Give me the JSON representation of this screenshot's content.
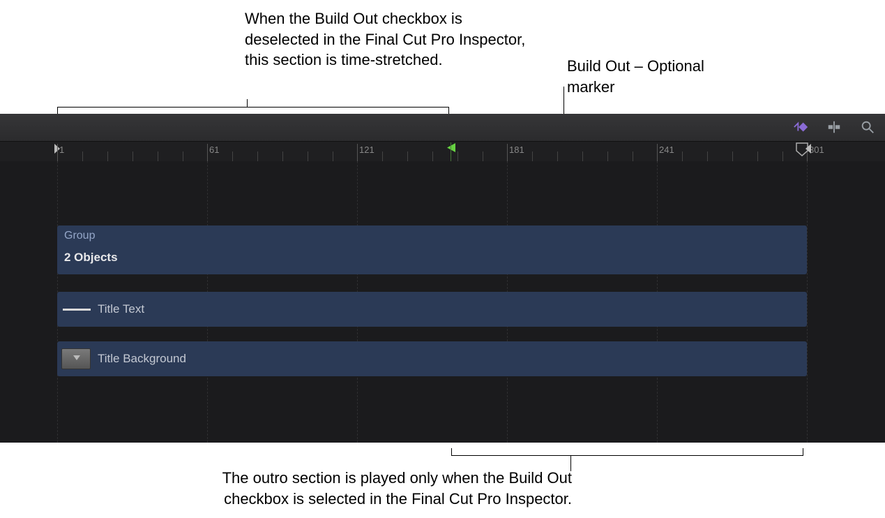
{
  "annotations": {
    "top_left": "When the Build Out checkbox is deselected in the Final Cut Pro Inspector, this section is time-stretched.",
    "top_right": "Build Out – Optional marker",
    "bottom": "The outro section is played only when the Build Out checkbox is selected in the Final Cut Pro Inspector."
  },
  "ruler": {
    "labels": [
      "1",
      "61",
      "121",
      "181",
      "241",
      "301"
    ]
  },
  "tracks": {
    "group_label": "Group",
    "group_sub": "2 Objects",
    "title_text": "Title Text",
    "title_bg": "Title Background"
  },
  "icons": {
    "keyframe": "keyframe-nav-icon",
    "snap": "snap-icon",
    "zoom": "zoom-icon"
  },
  "colors": {
    "track_fill": "#2b3a56",
    "marker_green": "#66d141",
    "range_dotted": "#c9a94a"
  }
}
